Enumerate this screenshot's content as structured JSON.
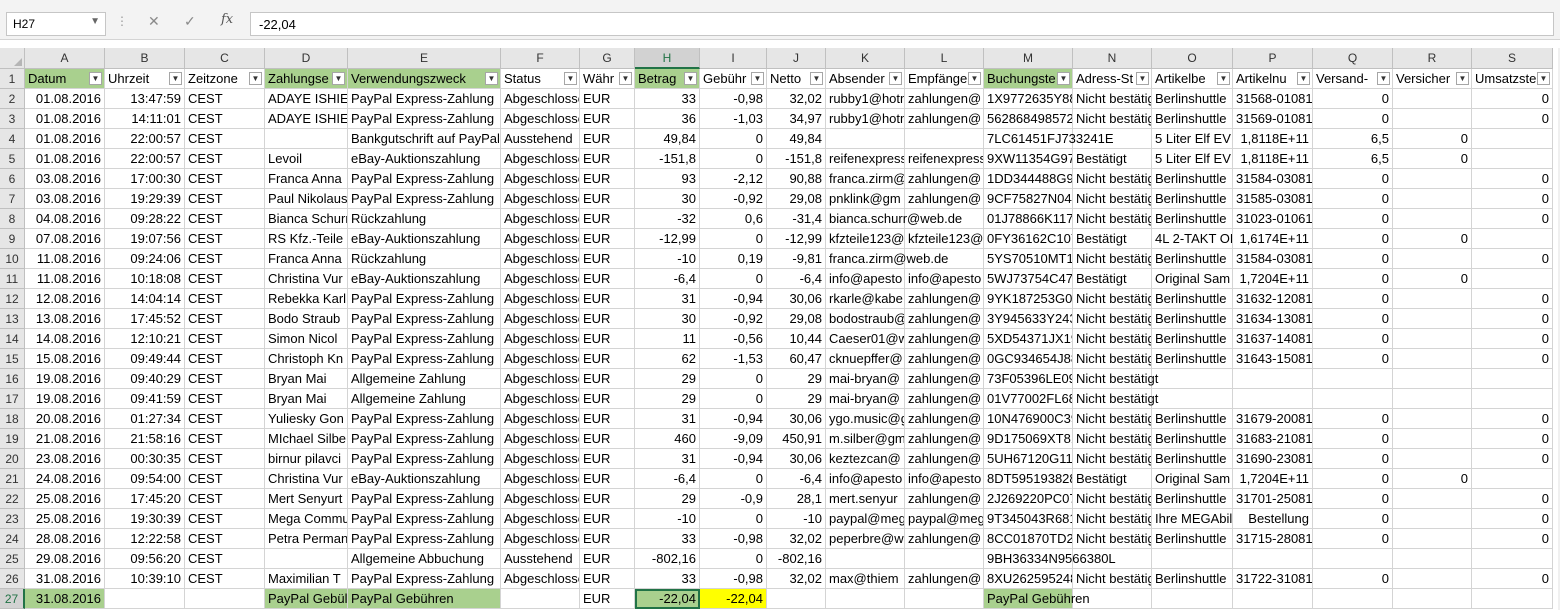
{
  "formula_bar": {
    "name_box": "H27",
    "cancel_icon": "✕",
    "enter_icon": "✓",
    "fx_label": "fx",
    "formula": "-22,04"
  },
  "columns": [
    {
      "letter": "A",
      "header": "Datum",
      "header_full": "Datum",
      "highlight": true,
      "align": "r"
    },
    {
      "letter": "B",
      "header": "Uhrzeit",
      "header_full": "Uhrzeit",
      "highlight": false,
      "align": "r"
    },
    {
      "letter": "C",
      "header": "Zeitzone",
      "header_full": "Zeitzone",
      "highlight": false,
      "align": "l"
    },
    {
      "letter": "D",
      "header": "Zahlungse",
      "header_full": "Zahlungse",
      "highlight": true,
      "align": "l"
    },
    {
      "letter": "E",
      "header": "Verwendungszweck",
      "header_full": "Verwendungszweck",
      "highlight": true,
      "align": "l"
    },
    {
      "letter": "F",
      "header": "Status",
      "header_full": "Status",
      "highlight": false,
      "align": "l"
    },
    {
      "letter": "G",
      "header": "Währ",
      "header_full": "Währ",
      "highlight": false,
      "align": "l"
    },
    {
      "letter": "H",
      "header": "Betrag",
      "header_full": "Betrag",
      "highlight": true,
      "align": "r"
    },
    {
      "letter": "I",
      "header": "Gebühr",
      "header_full": "Gebühr",
      "highlight": false,
      "align": "r"
    },
    {
      "letter": "J",
      "header": "Netto",
      "header_full": "Netto",
      "highlight": false,
      "align": "r"
    },
    {
      "letter": "K",
      "header": "Absender",
      "header_full": "Absender",
      "highlight": false,
      "align": "l"
    },
    {
      "letter": "L",
      "header": "Empfänge",
      "header_full": "Empfänge",
      "highlight": false,
      "align": "l"
    },
    {
      "letter": "M",
      "header": "Buchungste",
      "header_full": "Buchungste",
      "highlight": true,
      "align": "l"
    },
    {
      "letter": "N",
      "header": "Adress-St",
      "header_full": "Adress-St",
      "highlight": false,
      "align": "l"
    },
    {
      "letter": "O",
      "header": "Artikelbe",
      "header_full": "Artikelbe",
      "highlight": false,
      "align": "l"
    },
    {
      "letter": "P",
      "header": "Artikelnu",
      "header_full": "Artikelnu",
      "highlight": false,
      "align": "r"
    },
    {
      "letter": "Q",
      "header": "Versand-",
      "header_full": "Versand-",
      "highlight": false,
      "align": "r"
    },
    {
      "letter": "R",
      "header": "Versicher",
      "header_full": "Versicher",
      "highlight": false,
      "align": "r"
    },
    {
      "letter": "S",
      "header": "Umsatzste",
      "header_full": "Umsatzste",
      "highlight": false,
      "align": "r"
    }
  ],
  "rows": [
    [
      "01.08.2016",
      "13:47:59",
      "CEST",
      "ADAYE ISHIEK",
      "PayPal Express-Zahlung",
      "Abgeschlossen",
      "EUR",
      "33",
      "-0,98",
      "32,02",
      "rubby1@hotmail",
      "zahlungen@",
      "1X9772635Y885",
      "Nicht bestätigt",
      "Berlinshuttle",
      "31568-01081",
      "0",
      "",
      "0"
    ],
    [
      "01.08.2016",
      "14:11:01",
      "CEST",
      "ADAYE ISHIEK",
      "PayPal Express-Zahlung",
      "Abgeschlossen",
      "EUR",
      "36",
      "-1,03",
      "34,97",
      "rubby1@hotmail",
      "zahlungen@",
      "562868498572",
      "Nicht bestätigt",
      "Berlinshuttle",
      "31569-01081",
      "0",
      "",
      "0"
    ],
    [
      "01.08.2016",
      "22:00:57",
      "CEST",
      "",
      "Bankgutschrift auf PayPal",
      "Ausstehend",
      "EUR",
      "49,84",
      "0",
      "49,84",
      "",
      "",
      "7LC61451FJ733241E",
      "",
      "5 Liter Elf EV",
      "1,8118E+11",
      "6,5",
      "0",
      ""
    ],
    [
      "01.08.2016",
      "22:00:57",
      "CEST",
      "Levoil",
      "eBay-Auktionszahlung",
      "Abgeschlossen",
      "EUR",
      "-151,8",
      "0",
      "-151,8",
      "reifenexpress",
      "reifenexpress",
      "9XW11354G97",
      "Bestätigt",
      "5 Liter Elf EV",
      "1,8118E+11",
      "6,5",
      "0",
      ""
    ],
    [
      "03.08.2016",
      "17:00:30",
      "CEST",
      "Franca Anna",
      "PayPal Express-Zahlung",
      "Abgeschlossen",
      "EUR",
      "93",
      "-2,12",
      "90,88",
      "franca.zirm@",
      "zahlungen@",
      "1DD344488G96",
      "Nicht bestätigt",
      "Berlinshuttle",
      "31584-03081",
      "0",
      "",
      "0"
    ],
    [
      "03.08.2016",
      "19:29:39",
      "CEST",
      "Paul Nikolaus",
      "PayPal Express-Zahlung",
      "Abgeschlossen",
      "EUR",
      "30",
      "-0,92",
      "29,08",
      "pnklink@gm",
      "zahlungen@",
      "9CF75827N044",
      "Nicht bestätigt",
      "Berlinshuttle",
      "31585-03081",
      "0",
      "",
      "0"
    ],
    [
      "04.08.2016",
      "09:28:22",
      "CEST",
      "Bianca Schurr",
      "Rückzahlung",
      "Abgeschlossen",
      "EUR",
      "-32",
      "0,6",
      "-31,4",
      "bianca.schurr@web.de",
      "",
      "01J78866K1172",
      "Nicht bestätigt",
      "Berlinshuttle",
      "31023-01061",
      "0",
      "",
      "0"
    ],
    [
      "07.08.2016",
      "19:07:56",
      "CEST",
      "RS Kfz.-Teile",
      "eBay-Auktionszahlung",
      "Abgeschlossen",
      "EUR",
      "-12,99",
      "0",
      "-12,99",
      "kfzteile123@",
      "kfzteile123@",
      "0FY36162C107",
      "Bestätigt",
      "4L 2-TAKT OEL",
      "1,6174E+11",
      "0",
      "0",
      ""
    ],
    [
      "11.08.2016",
      "09:24:06",
      "CEST",
      "Franca Anna",
      "Rückzahlung",
      "Abgeschlossen",
      "EUR",
      "-10",
      "0,19",
      "-9,81",
      "franca.zirm@web.de",
      "",
      "5YS70510MT14",
      "Nicht bestätigt",
      "Berlinshuttle",
      "31584-03081",
      "0",
      "",
      "0"
    ],
    [
      "11.08.2016",
      "10:18:08",
      "CEST",
      "Christina Vur",
      "eBay-Auktionszahlung",
      "Abgeschlossen",
      "EUR",
      "-6,4",
      "0",
      "-6,4",
      "info@apesto",
      "info@apesto",
      "5WJ73754C476",
      "Bestätigt",
      "Original Sam",
      "1,7204E+11",
      "0",
      "0",
      ""
    ],
    [
      "12.08.2016",
      "14:04:14",
      "CEST",
      "Rebekka Karl",
      "PayPal Express-Zahlung",
      "Abgeschlossen",
      "EUR",
      "31",
      "-0,94",
      "30,06",
      "rkarle@kabe",
      "zahlungen@",
      "9YK187253G07",
      "Nicht bestätigt",
      "Berlinshuttle",
      "31632-12081",
      "0",
      "",
      "0"
    ],
    [
      "13.08.2016",
      "17:45:52",
      "CEST",
      "Bodo Straub",
      "PayPal Express-Zahlung",
      "Abgeschlossen",
      "EUR",
      "30",
      "-0,92",
      "29,08",
      "bodostraub@",
      "zahlungen@",
      "3Y945633Y243",
      "Nicht bestätigt",
      "Berlinshuttle",
      "31634-13081",
      "0",
      "",
      "0"
    ],
    [
      "14.08.2016",
      "12:10:21",
      "CEST",
      "Simon Nicol",
      "PayPal Express-Zahlung",
      "Abgeschlossen",
      "EUR",
      "11",
      "-0,56",
      "10,44",
      "Caeser01@w",
      "zahlungen@",
      "5XD54371JX19",
      "Nicht bestätigt",
      "Berlinshuttle",
      "31637-14081",
      "0",
      "",
      "0"
    ],
    [
      "15.08.2016",
      "09:49:44",
      "CEST",
      "Christoph Kn",
      "PayPal Express-Zahlung",
      "Abgeschlossen",
      "EUR",
      "62",
      "-1,53",
      "60,47",
      "cknuepffer@",
      "zahlungen@",
      "0GC934654J88",
      "Nicht bestätigt",
      "Berlinshuttle",
      "31643-15081",
      "0",
      "",
      "0"
    ],
    [
      "19.08.2016",
      "09:40:29",
      "CEST",
      "Bryan Mai",
      "Allgemeine Zahlung",
      "Abgeschlossen",
      "EUR",
      "29",
      "0",
      "29",
      "mai-bryan@",
      "zahlungen@",
      "73F05396LE097",
      "Nicht bestätigt",
      "",
      "",
      "",
      "",
      ""
    ],
    [
      "19.08.2016",
      "09:41:59",
      "CEST",
      "Bryan Mai",
      "Allgemeine Zahlung",
      "Abgeschlossen",
      "EUR",
      "29",
      "0",
      "29",
      "mai-bryan@",
      "zahlungen@",
      "01V77002FL68",
      "Nicht bestätigt",
      "",
      "",
      "",
      "",
      ""
    ],
    [
      "20.08.2016",
      "01:27:34",
      "CEST",
      "Yuliesky Gon",
      "PayPal Express-Zahlung",
      "Abgeschlossen",
      "EUR",
      "31",
      "-0,94",
      "30,06",
      "ygo.music@g",
      "zahlungen@",
      "10N476900C39",
      "Nicht bestätigt",
      "Berlinshuttle",
      "31679-20081",
      "0",
      "",
      "0"
    ],
    [
      "21.08.2016",
      "21:58:16",
      "CEST",
      "MIchael Silbe",
      "PayPal Express-Zahlung",
      "Abgeschlossen",
      "EUR",
      "460",
      "-9,09",
      "450,91",
      "m.silber@gm",
      "zahlungen@",
      "9D175069XT81",
      "Nicht bestätigt",
      "Berlinshuttle",
      "31683-21081",
      "0",
      "",
      "0"
    ],
    [
      "23.08.2016",
      "00:30:35",
      "CEST",
      "birnur pilavci",
      "PayPal Express-Zahlung",
      "Abgeschlossen",
      "EUR",
      "31",
      "-0,94",
      "30,06",
      "keztezcan@",
      "zahlungen@",
      "5UH67120G112",
      "Nicht bestätigt",
      "Berlinshuttle",
      "31690-23081",
      "0",
      "",
      "0"
    ],
    [
      "24.08.2016",
      "09:54:00",
      "CEST",
      "Christina Vur",
      "eBay-Auktionszahlung",
      "Abgeschlossen",
      "EUR",
      "-6,4",
      "0",
      "-6,4",
      "info@apesto",
      "info@apesto",
      "8DT595193828",
      "Bestätigt",
      "Original Sam",
      "1,7204E+11",
      "0",
      "0",
      ""
    ],
    [
      "25.08.2016",
      "17:45:20",
      "CEST",
      "Mert Senyurt",
      "PayPal Express-Zahlung",
      "Abgeschlossen",
      "EUR",
      "29",
      "-0,9",
      "28,1",
      "mert.senyur",
      "zahlungen@",
      "2J269220PC07",
      "Nicht bestätigt",
      "Berlinshuttle",
      "31701-25081",
      "0",
      "",
      "0"
    ],
    [
      "25.08.2016",
      "19:30:39",
      "CEST",
      "Mega Commu",
      "PayPal Express-Zahlung",
      "Abgeschlossen",
      "EUR",
      "-10",
      "0",
      "-10",
      "paypal@meg",
      "paypal@meg",
      "9T345043R681",
      "Nicht bestätigt",
      "Ihre MEGAbill",
      "Bestellung",
      "0",
      "",
      "0"
    ],
    [
      "28.08.2016",
      "12:22:58",
      "CEST",
      "Petra Perman",
      "PayPal Express-Zahlung",
      "Abgeschlossen",
      "EUR",
      "33",
      "-0,98",
      "32,02",
      "peperbre@w",
      "zahlungen@",
      "8CC01870TD20",
      "Nicht bestätigt",
      "Berlinshuttle",
      "31715-28081",
      "0",
      "",
      "0"
    ],
    [
      "29.08.2016",
      "09:56:20",
      "CEST",
      "",
      "Allgemeine Abbuchung",
      "Ausstehend",
      "EUR",
      "-802,16",
      "0",
      "-802,16",
      "",
      "",
      "9BH36334N9566380L",
      "",
      "",
      "",
      "",
      "",
      ""
    ],
    [
      "31.08.2016",
      "10:39:10",
      "CEST",
      "Maximilian T",
      "PayPal Express-Zahlung",
      "Abgeschlossen",
      "EUR",
      "33",
      "-0,98",
      "32,02",
      "max@thiem",
      "zahlungen@",
      "8XU262595248",
      "Nicht bestätigt",
      "Berlinshuttle",
      "31722-31081",
      "0",
      "",
      "0"
    ],
    [
      "31.08.2016",
      "",
      "",
      "PayPal Gebül",
      "PayPal Gebühren",
      "",
      "EUR",
      "-22,04",
      "-22,04",
      "",
      "",
      "",
      "PayPal Gebühren",
      "",
      "",
      "",
      "",
      "",
      ""
    ]
  ],
  "row_numbers": [
    "1",
    "2",
    "3",
    "4",
    "5",
    "6",
    "7",
    "8",
    "9",
    "10",
    "11",
    "12",
    "13",
    "14",
    "15",
    "16",
    "17",
    "18",
    "19",
    "20",
    "21",
    "22",
    "23",
    "24",
    "25",
    "26",
    "27"
  ],
  "active_cell": "H27",
  "colors": {
    "header_green": "#a9d08e",
    "highlight_yellow": "#ffff00",
    "selection": "#217346"
  }
}
